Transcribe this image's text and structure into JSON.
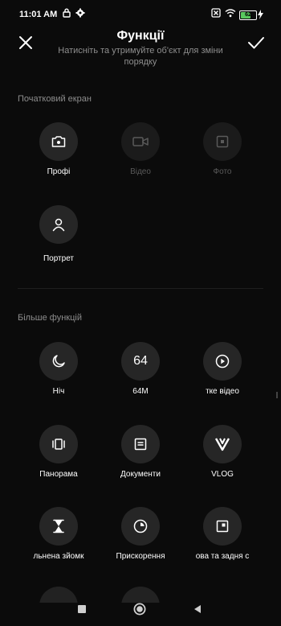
{
  "status": {
    "time": "11:01 AM",
    "battery": "62"
  },
  "header": {
    "title": "Функції",
    "subtitle": "Натисніть та утримуйте об'єкт для зміни порядку"
  },
  "home": {
    "label": "Початковий екран",
    "items": [
      {
        "label": "Профі",
        "icon": "camera-icon"
      },
      {
        "label": "Відео",
        "icon": "video-camera-icon"
      },
      {
        "label": "Фото",
        "icon": "photo-shutter-icon"
      },
      {
        "label": "Портрет",
        "icon": "person-icon"
      }
    ]
  },
  "more": {
    "label": "Більше функцій",
    "items": [
      {
        "label": "Ніч",
        "icon": "moon-icon"
      },
      {
        "label": "64M",
        "icon": "64-text",
        "glyph": "64"
      },
      {
        "label": "ткe відео",
        "icon": "play-circle-icon"
      },
      {
        "label": "Панорама",
        "icon": "panorama-icon"
      },
      {
        "label": "Документи",
        "icon": "document-icon"
      },
      {
        "label": "VLOG",
        "icon": "vlog-icon"
      },
      {
        "label": "льнена зйомк",
        "icon": "hourglass-icon"
      },
      {
        "label": "Прискорення",
        "icon": "timelapse-icon"
      },
      {
        "label": "ова та задня с",
        "icon": "dual-view-icon"
      }
    ]
  },
  "colors": {
    "background": "#0b0b0b",
    "tile": "#262626",
    "muted": "#8f8f8f",
    "disabled": "#5a5a5a"
  }
}
